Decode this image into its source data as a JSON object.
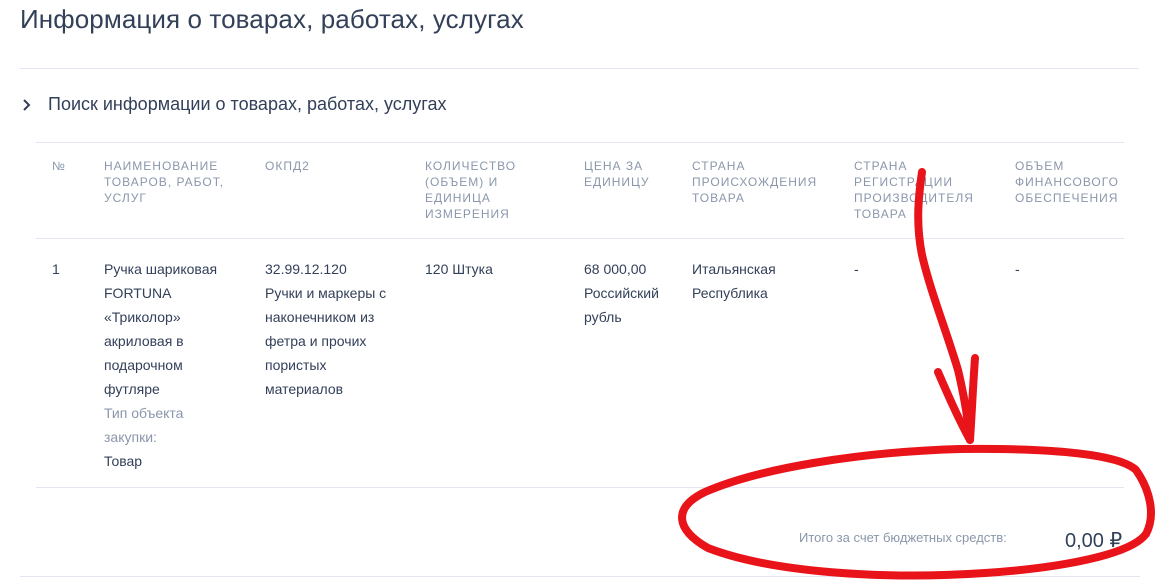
{
  "page": {
    "title": "Информация о товарах, работах, услугах"
  },
  "search": {
    "label": "Поиск информации о товарах, работах, услугах"
  },
  "table": {
    "headers": {
      "num": "№",
      "name": "НАИМЕНОВАНИЕ\nТОВАРОВ, РАБОТ,\nУСЛУГ",
      "okpd": "ОКПД2",
      "qty": "КОЛИЧЕСТВО\n(ОБЪЕМ) И\nЕДИНИЦА\nИЗМЕРЕНИЯ",
      "price": "ЦЕНА ЗА\nЕДИНИЦУ",
      "origin": "СТРАНА\nПРОИСХОЖДЕНИЯ\nТОВАРА",
      "producer": "СТРАНА\nРЕГИСТРАЦИИ\nПРОИЗВОДИТЕЛЯ\nТОВАРА",
      "funding": "ОБЪЕМ\nФИНАНСОВОГО\nОБЕСПЕЧЕНИЯ"
    },
    "rows": [
      {
        "num": "1",
        "name_lines": [
          "Ручка шариковая",
          "FORTUNA",
          "«Триколор»",
          "акриловая в",
          "подарочном",
          "футляре"
        ],
        "object_type_label_lines": [
          "Тип объекта",
          "закупки:"
        ],
        "object_type_value": "Товар",
        "okpd_code": "32.99.12.120",
        "okpd_lines": [
          "Ручки и маркеры с",
          "наконечником из",
          "фетра и прочих",
          "пористых",
          "материалов"
        ],
        "qty": "120 Штука",
        "price_lines": [
          "68 000,00",
          "Российский",
          "рубль"
        ],
        "origin_lines": [
          "Итальянская",
          "Республика"
        ],
        "producer": "-",
        "funding": "-"
      }
    ]
  },
  "summary": {
    "label": "Итого за счет бюджетных средств:",
    "value": "0,00 ₽"
  },
  "colors": {
    "text": "#334059",
    "muted": "#8a97ab",
    "divider": "#e4e7f2",
    "annotation": "#e8141a"
  }
}
